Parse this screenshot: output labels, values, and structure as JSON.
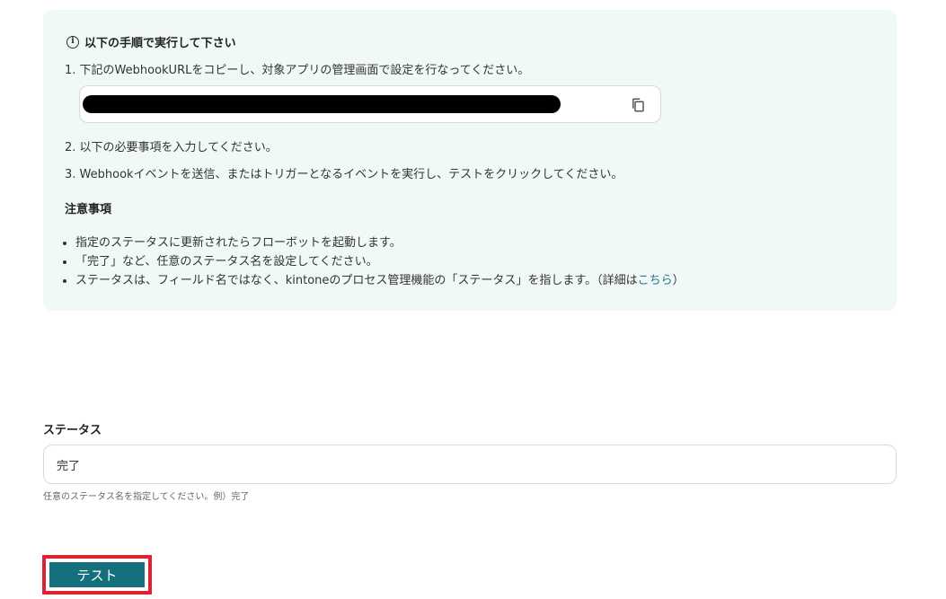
{
  "instructions": {
    "title": "以下の手順で実行して下さい",
    "step1": "1. 下記のWebhookURLをコピーし、対象アプリの管理画面で設定を行なってください。",
    "step2": "2. 以下の必要事項を入力してください。",
    "step3": "3. Webhookイベントを送信、またはトリガーとなるイベントを実行し、テストをクリックしてください。",
    "notes_heading": "注意事項",
    "notes": [
      "指定のステータスに更新されたらフローボットを起動します。",
      "「完了」など、任意のステータス名を設定してください。",
      "ステータスは、フィールド名ではなく、kintoneのプロセス管理機能の「ステータス」を指します。（詳細は"
    ],
    "notes_link": "こちら",
    "notes_link_suffix": "）",
    "url_box": {
      "value_redacted": true,
      "copy_icon": "copy-icon"
    }
  },
  "status_field": {
    "label": "ステータス",
    "value": "完了",
    "hint": "任意のステータス名を指定してください。例）完了"
  },
  "test_button": {
    "label": "テスト"
  },
  "colors": {
    "panel_bg": "#f1f8f8",
    "accent": "#15707e",
    "link": "#1a7a86",
    "highlight": "#e0212f"
  }
}
